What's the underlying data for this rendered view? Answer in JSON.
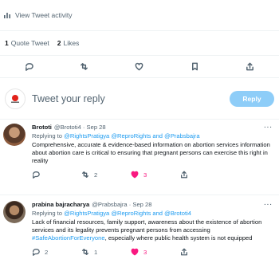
{
  "activity": {
    "label": "View Tweet activity"
  },
  "stats": {
    "quote_count": "1",
    "quote_label": "Quote Tweet",
    "likes_count": "2",
    "likes_label": "Likes"
  },
  "compose": {
    "placeholder": "Tweet your reply",
    "reply_label": "Reply",
    "avatar_icon": "organization-logo-icon"
  },
  "tweets": [
    {
      "name": "Brototi",
      "handle": "@Brototi4",
      "date": "Sep 28",
      "replying_prefix": "Replying to",
      "replying_to": "@RightsPratigya @ReproRights and @Prabsbajra",
      "body": "Comprehensive, accurate & evidence-based information on abortion services information about abortion care is critical to ensuring that pregnant persons can exercise this right in reality",
      "replies": "",
      "retweets": "2",
      "likes": "3",
      "more": "···"
    },
    {
      "name": "prabina bajracharya",
      "handle": "@Prabsbajra",
      "date": "Sep 28",
      "replying_prefix": "Replying to",
      "replying_to": "@RightsPratigya @ReproRights and @Brototi4",
      "body_pre": "Lack of financial resources, family support, awareness about the existence of abortion services and its legality prevents pregnant persons from accessing ",
      "body_hashtag": "#SafeAbortionForEveryone",
      "body_post": ", especially where public health system is not equipped",
      "replies": "2",
      "retweets": "1",
      "likes": "3",
      "more": "···"
    }
  ]
}
